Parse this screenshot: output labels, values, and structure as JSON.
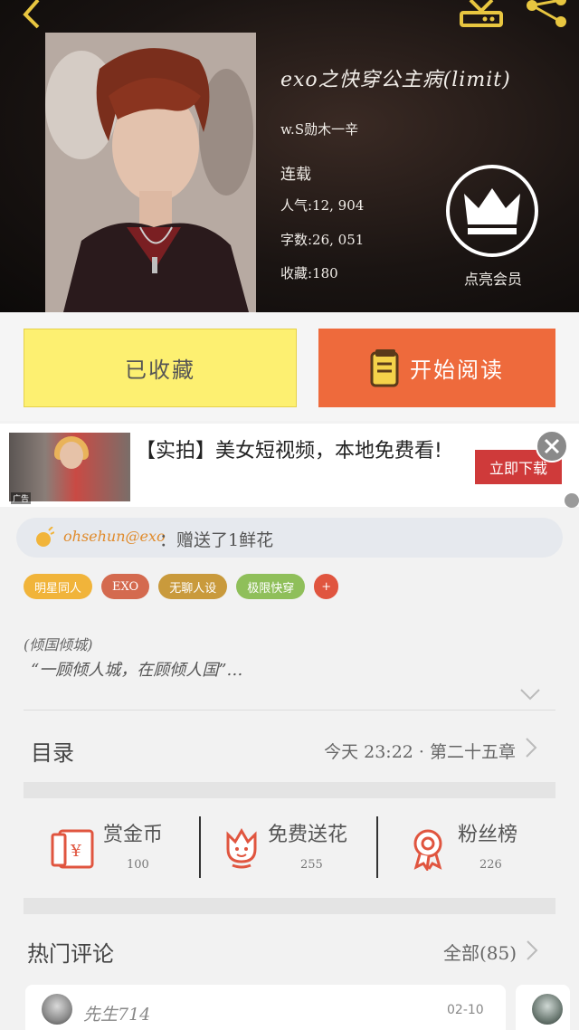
{
  "book": {
    "title": "exo之快穿公主病(limit)",
    "author": "w.S勋木一辛",
    "status": "连载",
    "popularity": "人气:12, 904",
    "words": "字数:26, 051",
    "favorites": "收藏:180",
    "vip_label": "点亮会员"
  },
  "actions": {
    "favorited_label": "已收藏",
    "read_label": "开始阅读"
  },
  "ad": {
    "text": "【实拍】美女短视频，本地免费看!",
    "tag": "广告",
    "download_label": "立即下载"
  },
  "gift": {
    "user": "ohsehun@exo",
    "text": "：赠送了1鲜花"
  },
  "tags": [
    {
      "label": "明星同人",
      "color": "#f1b43a"
    },
    {
      "label": "EXO",
      "color": "#d46a4f"
    },
    {
      "label": "无聊人设",
      "color": "#c99a3c"
    },
    {
      "label": "极限快穿",
      "color": "#8fbf5a"
    },
    {
      "label": "+",
      "color": "#e0553f"
    }
  ],
  "intro": {
    "line1": "(倾国倾城)",
    "line2": "“一顾倾人城，在顾倾人国”…"
  },
  "toc": {
    "label": "目录",
    "latest": "今天 23:22 · 第二十五章"
  },
  "rewards": [
    {
      "label": "赏金币",
      "count": "100"
    },
    {
      "label": "免费送花",
      "count": "255"
    },
    {
      "label": "粉丝榜",
      "count": "226"
    }
  ],
  "hot_comments": {
    "title": "热门评论",
    "all_label": "全部(85)",
    "items": [
      {
        "user": "先生714",
        "date": "02-10"
      }
    ]
  },
  "colors": {
    "favorite_button": "#fdf071",
    "read_button": "#ee6a3c",
    "reward_icon": "#e0553f",
    "ad_button": "#cf3a3a"
  }
}
